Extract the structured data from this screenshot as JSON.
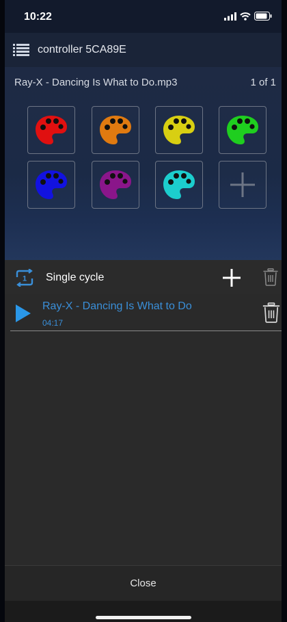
{
  "status_bar": {
    "time": "10:22"
  },
  "header": {
    "title": "controller 5CA89E"
  },
  "track": {
    "name": "Ray-X - Dancing Is What to Do.mp3",
    "count": "1 of 1"
  },
  "palettes": [
    {
      "color": "#e01010"
    },
    {
      "color": "#e07a10"
    },
    {
      "color": "#d8cf12"
    },
    {
      "color": "#1fce1f"
    },
    {
      "color": "#1212e0"
    },
    {
      "color": "#8a168a"
    },
    {
      "color": "#1ccdcd"
    }
  ],
  "cycle": {
    "badge": "1",
    "label": "Single cycle"
  },
  "songs": [
    {
      "title": "Ray-X - Dancing Is What to Do",
      "duration": "04:17"
    }
  ],
  "footer": {
    "close_label": "Close"
  },
  "colors": {
    "accent": "#3a8fd9",
    "tile_border": "#6d7585"
  },
  "icons": [
    "menu-list-icon",
    "palette-icon",
    "plus-icon",
    "repeat-one-icon",
    "trash-icon",
    "play-icon",
    "signal-icon",
    "wifi-icon",
    "battery-icon"
  ]
}
